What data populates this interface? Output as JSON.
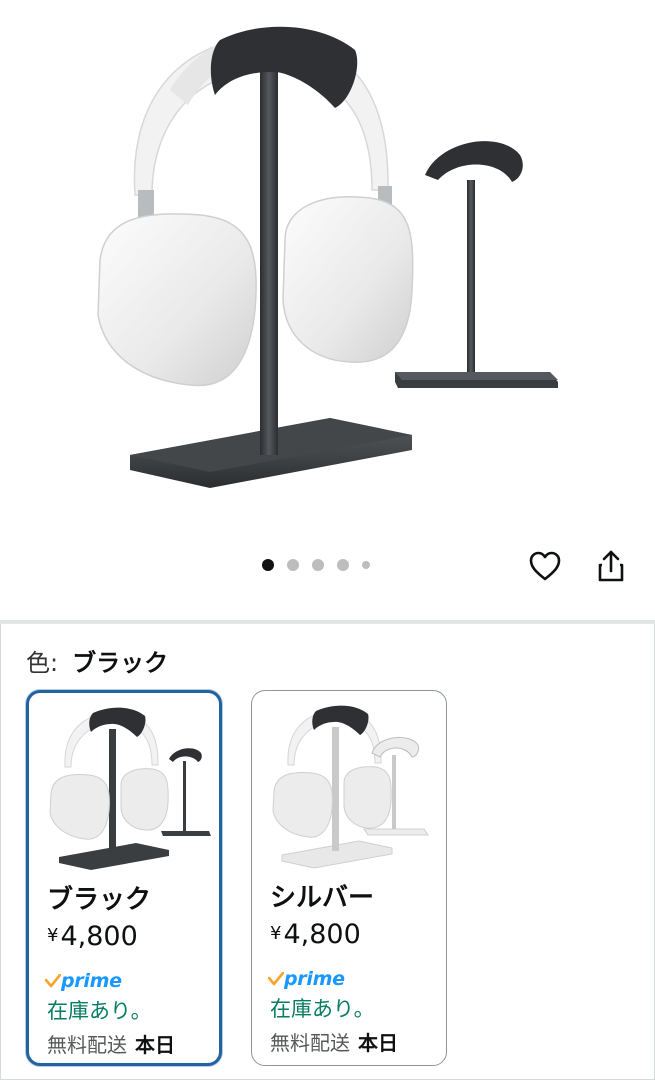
{
  "gallery": {
    "image_alt": "headphone-stand-product-image",
    "dot_count": 5,
    "active_dot": 0
  },
  "icons": {
    "wishlist": "heart-icon",
    "share": "share-icon",
    "prime_check": "prime-check-icon"
  },
  "color_selector": {
    "label": "色:",
    "selected_value": "ブラック",
    "options": [
      {
        "name": "ブラック",
        "currency": "¥",
        "price": "4,800",
        "prime": "prime",
        "stock": "在庫あり。",
        "shipping_label": "無料配送",
        "shipping_day": "本日",
        "selected": true
      },
      {
        "name": "シルバー",
        "currency": "¥",
        "price": "4,800",
        "prime": "prime",
        "stock": "在庫あり。",
        "shipping_label": "無料配送",
        "shipping_day": "本日",
        "selected": false
      }
    ]
  },
  "colors": {
    "selected_border": "#2162a1",
    "stock_green": "#067d62",
    "prime_blue": "#1a98ff",
    "prime_check_orange": "#f7a42c"
  }
}
